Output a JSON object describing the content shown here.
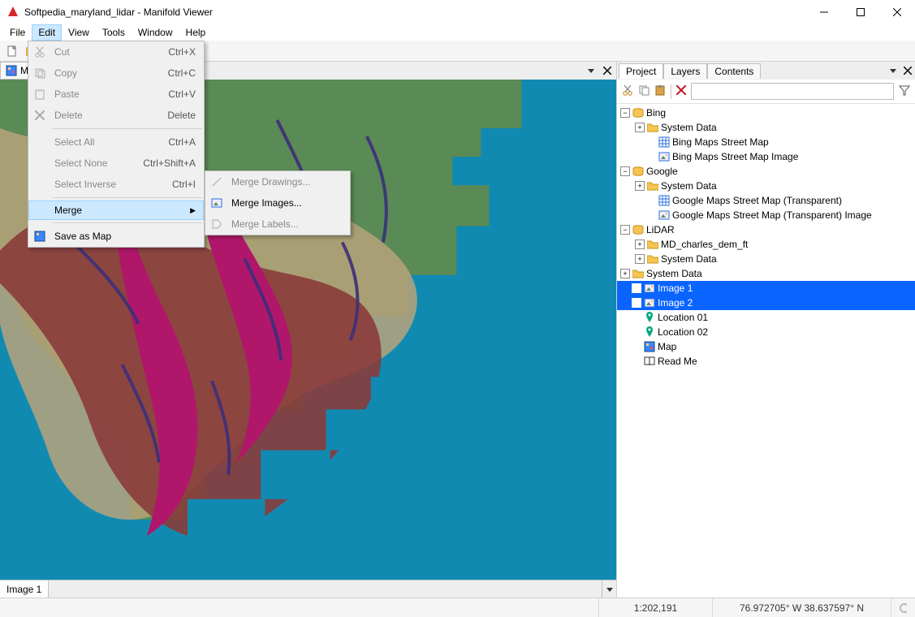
{
  "window": {
    "title": "Softpedia_maryland_lidar - Manifold Viewer"
  },
  "menubar": {
    "items": [
      "File",
      "Edit",
      "View",
      "Tools",
      "Window",
      "Help"
    ],
    "active_index": 1
  },
  "edit_menu": {
    "cut": {
      "label": "Cut",
      "accel": "Ctrl+X"
    },
    "copy": {
      "label": "Copy",
      "accel": "Ctrl+C"
    },
    "paste": {
      "label": "Paste",
      "accel": "Ctrl+V"
    },
    "delete": {
      "label": "Delete",
      "accel": "Delete"
    },
    "select_all": {
      "label": "Select All",
      "accel": "Ctrl+A"
    },
    "select_none": {
      "label": "Select None",
      "accel": "Ctrl+Shift+A"
    },
    "select_inverse": {
      "label": "Select Inverse",
      "accel": "Ctrl+I"
    },
    "merge": {
      "label": "Merge"
    },
    "save_as_map": {
      "label": "Save as Map"
    }
  },
  "merge_submenu": {
    "drawings": {
      "label": "Merge Drawings..."
    },
    "images": {
      "label": "Merge Images..."
    },
    "labels": {
      "label": "Merge Labels..."
    }
  },
  "map_tab": {
    "label": "M..."
  },
  "image_footer_tab": {
    "label": "Image 1"
  },
  "side": {
    "tabs": [
      "Project",
      "Layers",
      "Contents"
    ],
    "active_index": 0,
    "filter_placeholder": ""
  },
  "tree": {
    "bing": {
      "label": "Bing",
      "system": "System Data",
      "street": "Bing Maps Street Map",
      "street_img": "Bing Maps Street Map Image"
    },
    "google": {
      "label": "Google",
      "system": "System Data",
      "street": "Google Maps Street Map (Transparent)",
      "street_img": "Google Maps Street Map (Transparent) Image"
    },
    "lidar": {
      "label": "LiDAR",
      "md": "MD_charles_dem_ft",
      "system": "System Data"
    },
    "system_root": {
      "label": "System Data"
    },
    "image1": {
      "label": "Image 1"
    },
    "image2": {
      "label": "Image 2"
    },
    "loc1": {
      "label": "Location 01"
    },
    "loc2": {
      "label": "Location 02"
    },
    "map": {
      "label": "Map"
    },
    "readme": {
      "label": "Read Me"
    }
  },
  "status": {
    "scale": "1:202,191",
    "coord": "76.972705° W 38.637597° N"
  },
  "colors": {
    "water": "#118ab2",
    "lowland": "#8a3b3b",
    "high": "#5a8a55",
    "mid": "#b7a27a",
    "river": "#b0176b",
    "valley": "#3b2f7a"
  }
}
